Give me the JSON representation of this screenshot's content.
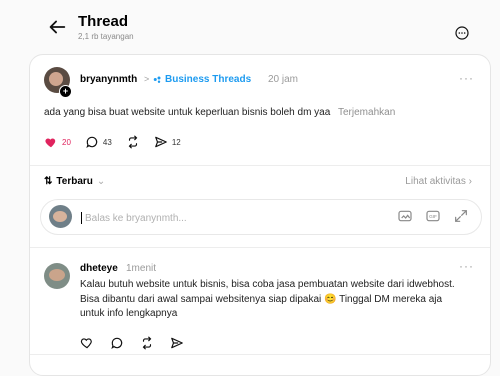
{
  "header": {
    "title": "Thread",
    "views": "2,1 rb tayangan"
  },
  "post": {
    "username": "bryanynmth",
    "separator": ">",
    "community": "Business Threads",
    "time": "20 jam",
    "text": "ada yang bisa buat website untuk keperluan bisnis boleh dm yaa",
    "translate_label": "Terjemahkan",
    "likes": "20",
    "comments": "43",
    "shares": "12"
  },
  "sort": {
    "label": "Terbaru",
    "activity_label": "Lihat aktivitas"
  },
  "reply": {
    "placeholder": "Balas ke bryanynmth..."
  },
  "comment": {
    "username": "dheteye",
    "time": "1menit",
    "text": "Kalau butuh website untuk bisnis, bisa coba jasa pembuatan website dari idwebhost. Bisa dibantu dari awal sampai websitenya siap dipakai 😊 Tinggal DM mereka aja untuk info lengkapnya"
  },
  "icons": {
    "back": "arrow-left-icon",
    "more": "more-icon",
    "like": "heart-icon",
    "comment": "comment-icon",
    "repost": "repost-icon",
    "share": "share-icon",
    "gif": "gif-icon",
    "image": "image-icon",
    "expand": "expand-icon"
  },
  "colors": {
    "accent_blue": "#1d9bf0",
    "like_red": "#e0245e"
  }
}
